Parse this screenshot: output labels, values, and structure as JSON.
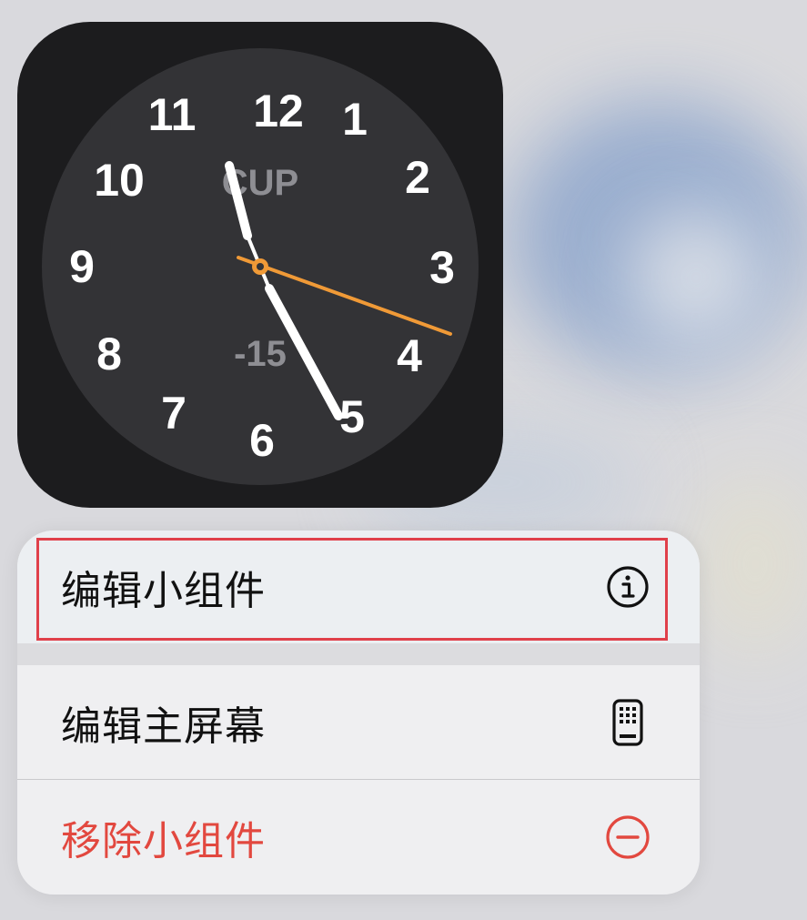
{
  "clock_widget": {
    "numerals": [
      "12",
      "1",
      "2",
      "3",
      "4",
      "5",
      "6",
      "7",
      "8",
      "9",
      "10",
      "11"
    ],
    "city": "CUP",
    "offset": "-15",
    "colors": {
      "background": "#1c1c1e",
      "face": "#333336",
      "hands": "#ffffff",
      "second_hand": "#f09a37"
    }
  },
  "context_menu": {
    "items": [
      {
        "label": "编辑小组件",
        "icon": "info-circle-icon"
      },
      {
        "label": "编辑主屏幕",
        "icon": "phone-grid-icon"
      },
      {
        "label": "移除小组件",
        "icon": "minus-circle-icon",
        "destructive": true
      }
    ],
    "colors": {
      "destructive": "#e2483f",
      "highlight": "#e0404a"
    }
  }
}
